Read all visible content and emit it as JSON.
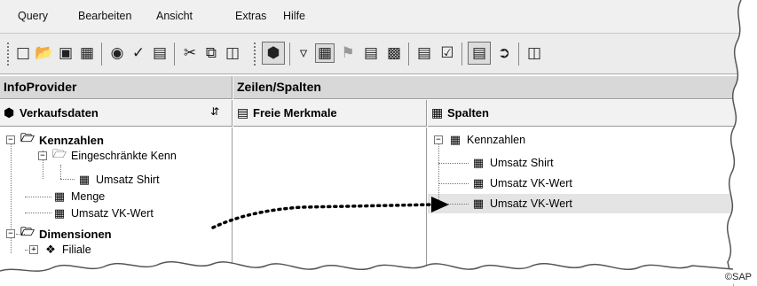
{
  "menu": {
    "items": [
      "Query",
      "Bearbeiten",
      "Ansicht",
      "Extras",
      "Hilfe"
    ]
  },
  "toolbar": {
    "icons": [
      "new-icon",
      "open-icon",
      "save-icon",
      "save-all-icon",
      "execute-icon",
      "check-icon",
      "properties-icon",
      "cut-icon",
      "copy-icon",
      "paste-icon",
      "cube-icon",
      "filter-icon",
      "rows-columns-icon",
      "conditions-icon",
      "exceptions-icon",
      "cells-icon",
      "table-icon",
      "tasks-icon",
      "preview-icon",
      "publish-icon",
      "more-icon"
    ]
  },
  "infoprovider": {
    "header": "InfoProvider",
    "selector": "Verkaufsdaten",
    "tree": {
      "kennzahlen": "Kennzahlen",
      "eingeschraenkte": "Eingeschränkte Kenn",
      "umsatz_shirt": "Umsatz Shirt",
      "menge": "Menge",
      "umsatz_vk": "Umsatz VK-Wert",
      "dimensionen": "Dimensionen",
      "filiale": "Filiale"
    }
  },
  "zeilen_spalten": {
    "header": "Zeilen/Spalten",
    "freie_merkmale": "Freie Merkmale",
    "spalten": "Spalten",
    "tree": {
      "kennzahlen": "Kennzahlen",
      "items": [
        "Umsatz Shirt",
        "Umsatz VK-Wert",
        "Umsatz VK-Wert"
      ]
    }
  },
  "copyright": "©SAP"
}
